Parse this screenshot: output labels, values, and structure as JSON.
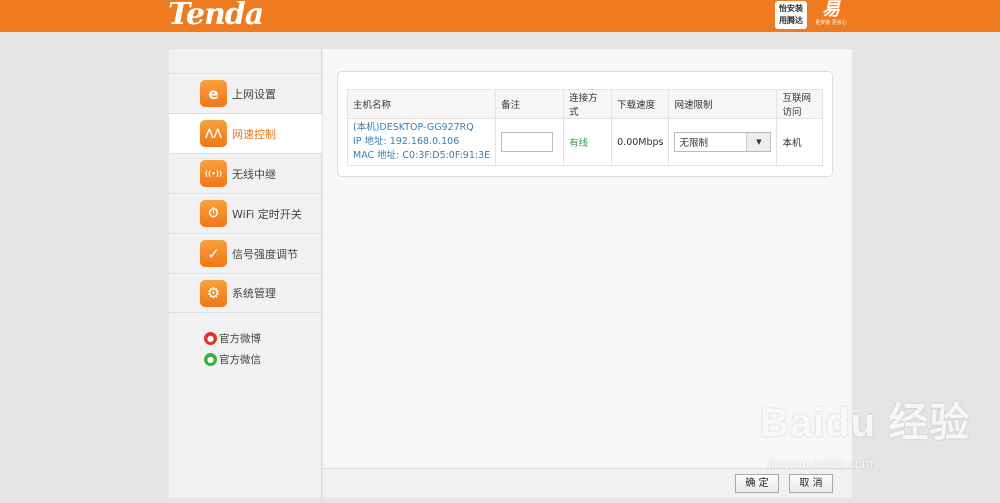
{
  "header": {
    "logo_text": "Tenda",
    "badge_line1": "怡安装",
    "badge_line2": "用腾达",
    "badge2_mark": "易",
    "badge2_sub": "更安装 更省心"
  },
  "sidebar": {
    "items": [
      {
        "label": "上网设置",
        "icon": "e-icon",
        "glyph": "e"
      },
      {
        "label": "网速控制",
        "icon": "speed-control-icon",
        "glyph": "⋀⋀"
      },
      {
        "label": "无线中继",
        "icon": "wireless-repeater-icon",
        "glyph": "((•))"
      },
      {
        "label": "WiFi 定时开关",
        "icon": "wifi-timer-icon",
        "glyph": "⏱"
      },
      {
        "label": "信号强度调节",
        "icon": "signal-strength-icon",
        "glyph": "✓"
      },
      {
        "label": "系统管理",
        "icon": "gear-icon",
        "glyph": "⚙"
      }
    ],
    "active_index": 1,
    "social": [
      {
        "label": "官方微博",
        "icon": "weibo-icon"
      },
      {
        "label": "官方微信",
        "icon": "wechat-icon"
      }
    ]
  },
  "table": {
    "headers": [
      "主机名称",
      "备注",
      "连接方式",
      "下载速度",
      "网速限制",
      "互联网访问"
    ],
    "rows": [
      {
        "host_name": "(本机)DESKTOP-GG927RQ",
        "ip": "IP 地址: 192.168.0.106",
        "mac": "MAC 地址: C0:3F:D5:0F:91:3E",
        "note": "",
        "connection": "有线",
        "download_speed": "0.00Mbps",
        "speed_limit": "无限制",
        "internet_access": "本机"
      }
    ]
  },
  "footer": {
    "ok_label": "确 定",
    "cancel_label": "取 消"
  },
  "watermark": {
    "main": "Baidu 经验",
    "sub": "jingyan.baidu.com"
  },
  "colors": {
    "brand_orange": "#f07a1f",
    "link_blue": "#3a7fb0",
    "status_green": "#3a9b46"
  }
}
